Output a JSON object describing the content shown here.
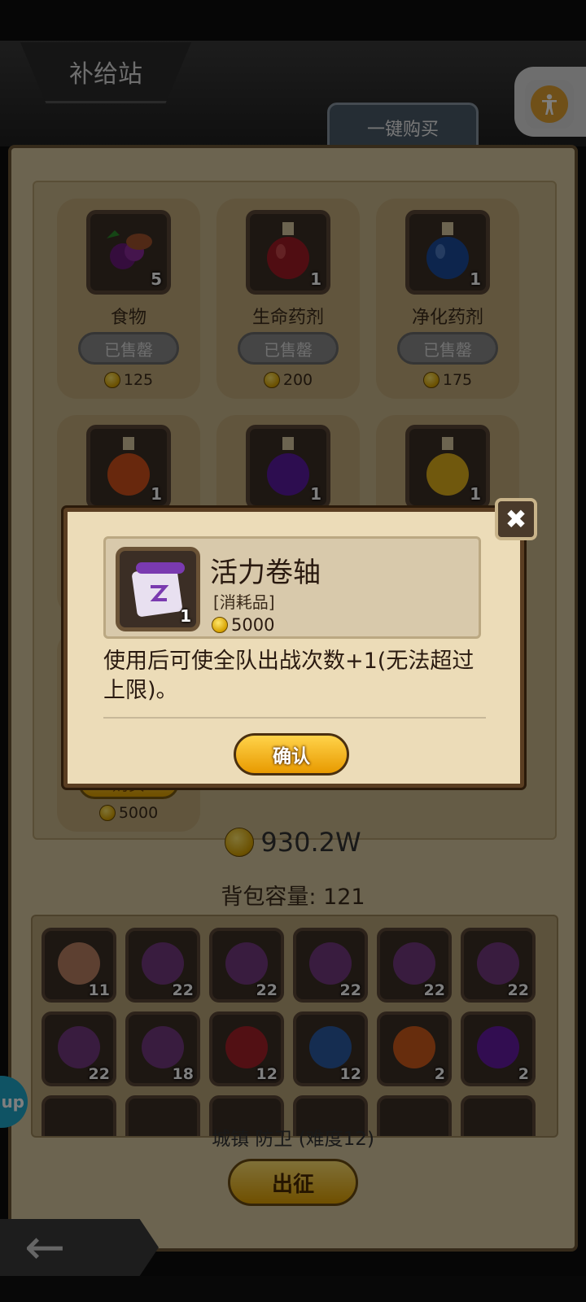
{
  "header": {
    "title": "补给站",
    "buy_all_label": "一键购买",
    "accessibility_icon": "person-icon"
  },
  "shop": {
    "items": [
      {
        "name": "食物",
        "qty": "5",
        "status": "已售罄",
        "price": "125",
        "icon": "food-icon"
      },
      {
        "name": "生命药剂",
        "qty": "1",
        "status": "已售罄",
        "price": "200",
        "icon": "red-potion-icon"
      },
      {
        "name": "净化药剂",
        "qty": "1",
        "status": "已售罄",
        "price": "175",
        "icon": "blue-potion-icon"
      },
      {
        "name": "",
        "qty": "1",
        "icon": "orange-potion-icon"
      },
      {
        "name": "",
        "qty": "1",
        "icon": "purple-potion-icon"
      },
      {
        "name": "",
        "qty": "1",
        "icon": "yellow-potion-icon"
      }
    ],
    "partial_card": {
      "button_label": "购买",
      "price": "5000"
    }
  },
  "wallet": {
    "amount": "930.2W"
  },
  "bag": {
    "capacity_label": "背包容量: 121",
    "slots": [
      {
        "qty": "11",
        "icon": "meat-icon",
        "color": "#c98a6a"
      },
      {
        "qty": "22",
        "icon": "food-icon",
        "color": "#7a3a8a"
      },
      {
        "qty": "22",
        "icon": "food-icon",
        "color": "#7a3a8a"
      },
      {
        "qty": "22",
        "icon": "food-icon",
        "color": "#7a3a8a"
      },
      {
        "qty": "22",
        "icon": "food-icon",
        "color": "#7a3a8a"
      },
      {
        "qty": "22",
        "icon": "food-icon",
        "color": "#7a3a8a"
      },
      {
        "qty": "22",
        "icon": "food-icon",
        "color": "#7a3a8a"
      },
      {
        "qty": "18",
        "icon": "food-icon",
        "color": "#7a3a8a"
      },
      {
        "qty": "12",
        "icon": "red-potion-icon",
        "color": "#b0202a"
      },
      {
        "qty": "12",
        "icon": "blue-potion-icon",
        "color": "#2a60b0"
      },
      {
        "qty": "2",
        "icon": "orange-potion-icon",
        "color": "#e0601a"
      },
      {
        "qty": "2",
        "icon": "purple-potion-icon",
        "color": "#6a1ab0"
      }
    ]
  },
  "footer": {
    "stage_label": "城镇 防卫 (难度12)",
    "go_label": "出征",
    "side_pill_label": "up"
  },
  "modal": {
    "name": "活力卷轴",
    "type": "[消耗品]",
    "qty": "1",
    "price": "5000",
    "description": "使用后可使全队出战次数+1(无法超过上限)。",
    "confirm_label": "确认",
    "icon": "scroll-icon"
  },
  "colors": {
    "panel": "#d8c8a0",
    "accent_gold": "#e0a000",
    "sold_out_gray": "#8a8a8a"
  }
}
